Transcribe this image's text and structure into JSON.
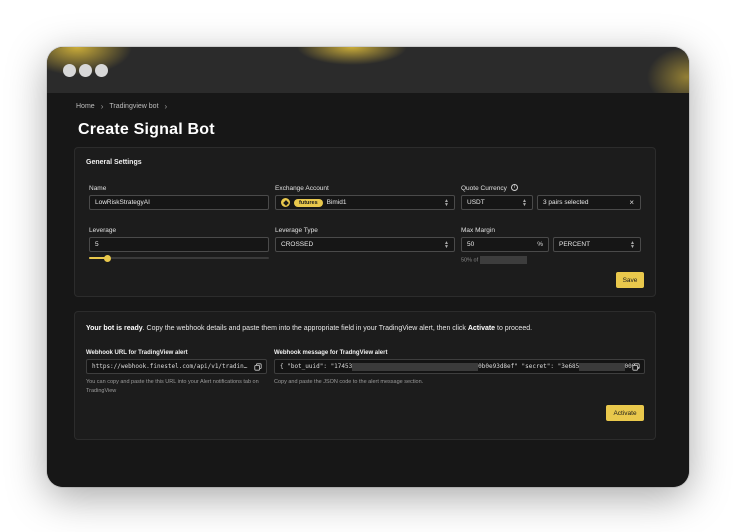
{
  "breadcrumb": [
    "Home",
    "Tradingview bot"
  ],
  "page_title": "Create Signal Bot",
  "general": {
    "section_title": "General Settings",
    "name_label": "Name",
    "name_value": "LowRiskStrategyAI",
    "exchange_label": "Exchange Account",
    "exchange_badge": "futures",
    "exchange_value": "Bimid1",
    "quote_label": "Quote Currency",
    "quote_value": "USDT",
    "pairs_value": "3 pairs selected",
    "leverage_label": "Leverage",
    "leverage_value": "5",
    "leverage_slider_fraction": 0.1,
    "leverage_type_label": "Leverage Type",
    "leverage_type_value": "CROSSED",
    "max_margin_label": "Max Margin",
    "max_margin_value": "50",
    "max_margin_unit": "%",
    "max_margin_mode": "PERCENT",
    "max_margin_hint": "50% of",
    "save_label": "Save"
  },
  "webhook": {
    "ready_bold": "Your bot is ready",
    "ready_text": ". Copy the webhook details and paste them into the appropriate field in your TradingView alert, then click ",
    "ready_action": "Activate",
    "ready_tail": " to proceed.",
    "url_label": "Webhook URL for TradingView alert",
    "url_value": "https://webhook.finestel.com/api/v1/tradin…",
    "url_help": "You can copy and paste the this URL into your Alert notifications tab on TradingView",
    "message_label": "Webhook message for TradngView alert",
    "message_part1": "{ \"bot_uuid\": \"17453",
    "message_part2": "0b0e93d8ef\" \"secret\": \"3e685",
    "message_part3": "009…",
    "message_help": "Copy and paste the JSON code to the alert message section.",
    "activate_label": "Activate"
  },
  "colors": {
    "accent": "#e9c84c",
    "background": "#171717"
  }
}
